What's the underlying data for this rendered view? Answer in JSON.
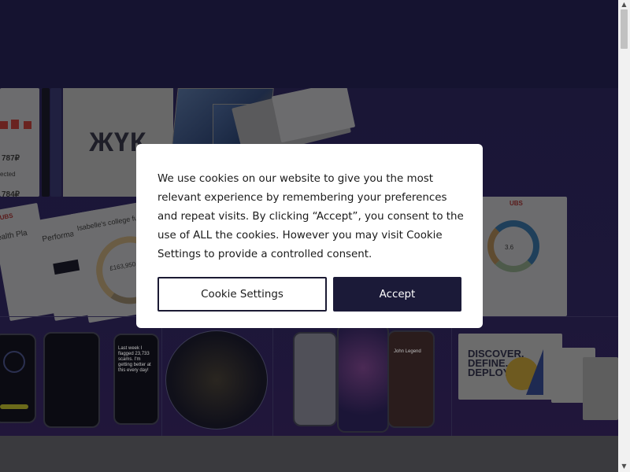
{
  "cookie_banner": {
    "message": "We use cookies on our website to give you the most relevant experience by remembering your preferences and repeat visits. By clicking “Accept”, you consent to the use of ALL the cookies. However you may visit Cookie Settings to provide a controlled consent.",
    "settings_label": "Cookie Settings",
    "accept_label": "Accept"
  },
  "hero": {
    "kyk_logo_text": "ЖҮК",
    "collage_text": {
      "price_1": "787₽",
      "price_2": "784₽",
      "expected": "ected",
      "ubs_1": "UBS",
      "ubs_2": "UBS",
      "health": "ealth Pla",
      "perform": "Performa",
      "college": "Isabelle's college fund",
      "fund_value": "£163,950.0",
      "donut_value": "3.6",
      "poster_line_1": "DISCOVER.",
      "poster_line_2": "DEFINE.",
      "poster_line_3": "DEPLOY.",
      "music_artist": "John Legend",
      "last_week": "Last week I flagged 23,733 scams. I'm getting better at this every day!"
    }
  },
  "colors": {
    "page_background": "#15132d",
    "dialog_background": "#ffffff",
    "accent": "#1b1a38",
    "scrollbar_track": "#f1f1f1",
    "scrollbar_thumb": "#c1c1c1"
  },
  "icons": {
    "scroll_up": "scroll-up-arrow-icon",
    "scroll_down": "scroll-down-arrow-icon"
  }
}
